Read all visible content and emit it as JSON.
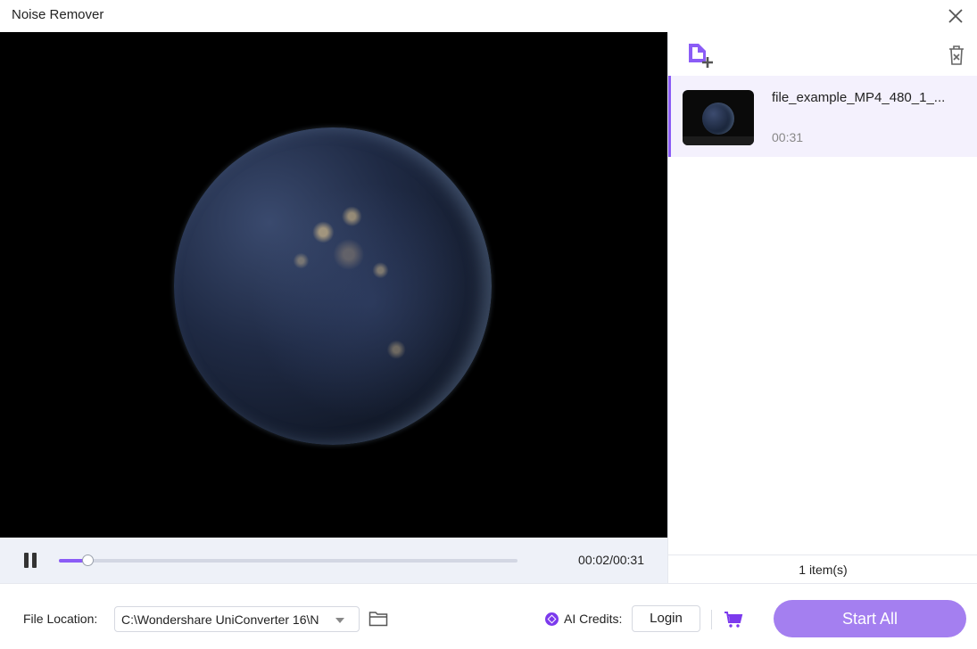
{
  "window": {
    "title": "Noise Remover",
    "close_icon": "close-icon"
  },
  "player": {
    "time": "00:02/00:31",
    "progress": 0.065,
    "pause_icon": "pause-icon"
  },
  "file_list": {
    "add_icon": "add-file-icon",
    "trash_icon": "trash-icon",
    "items": [
      {
        "name": "file_example_MP4_480_1_...",
        "duration": "00:31"
      }
    ],
    "count": "1 item(s)"
  },
  "footer": {
    "location_label": "File Location:",
    "location_value": "C:\\Wondershare UniConverter 16\\N",
    "credits_label": "AI Credits:",
    "login_label": "Login",
    "start_label": "Start All"
  },
  "colors": {
    "accent": "#8b5cf6",
    "start_button": "#a47ff0",
    "selected_row": "#f4f1fd"
  }
}
